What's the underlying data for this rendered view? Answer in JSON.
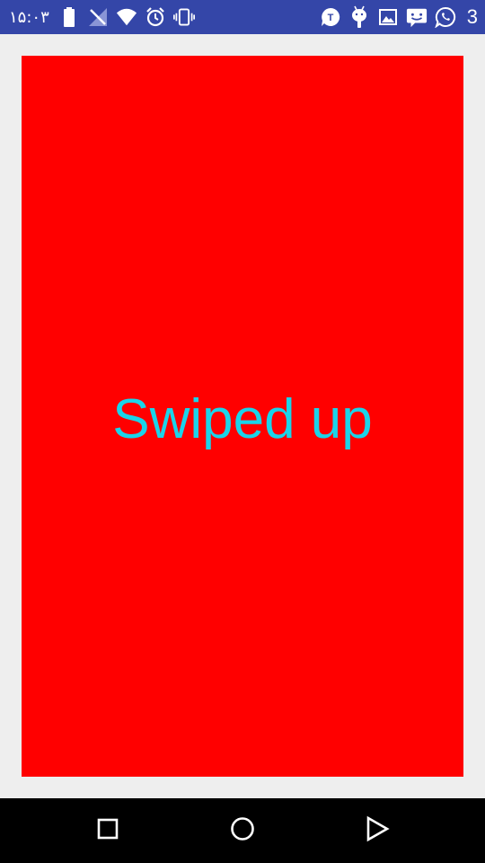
{
  "status_bar": {
    "time": "۱۵:۰۳",
    "notification_count": "3",
    "background_color": "#3446a8",
    "left_icons": [
      "battery-icon",
      "no-signal-icon",
      "wifi-icon",
      "alarm-icon",
      "vibrate-icon"
    ],
    "right_icons": [
      "t-app-icon",
      "android-icon",
      "image-icon",
      "messenger-icon",
      "whatsapp-icon"
    ]
  },
  "main": {
    "label": "Swiped up",
    "background_color": "#ff0000",
    "text_color": "#1ad4ea"
  },
  "nav_bar": {
    "buttons": [
      "recent-apps",
      "home",
      "back"
    ]
  }
}
